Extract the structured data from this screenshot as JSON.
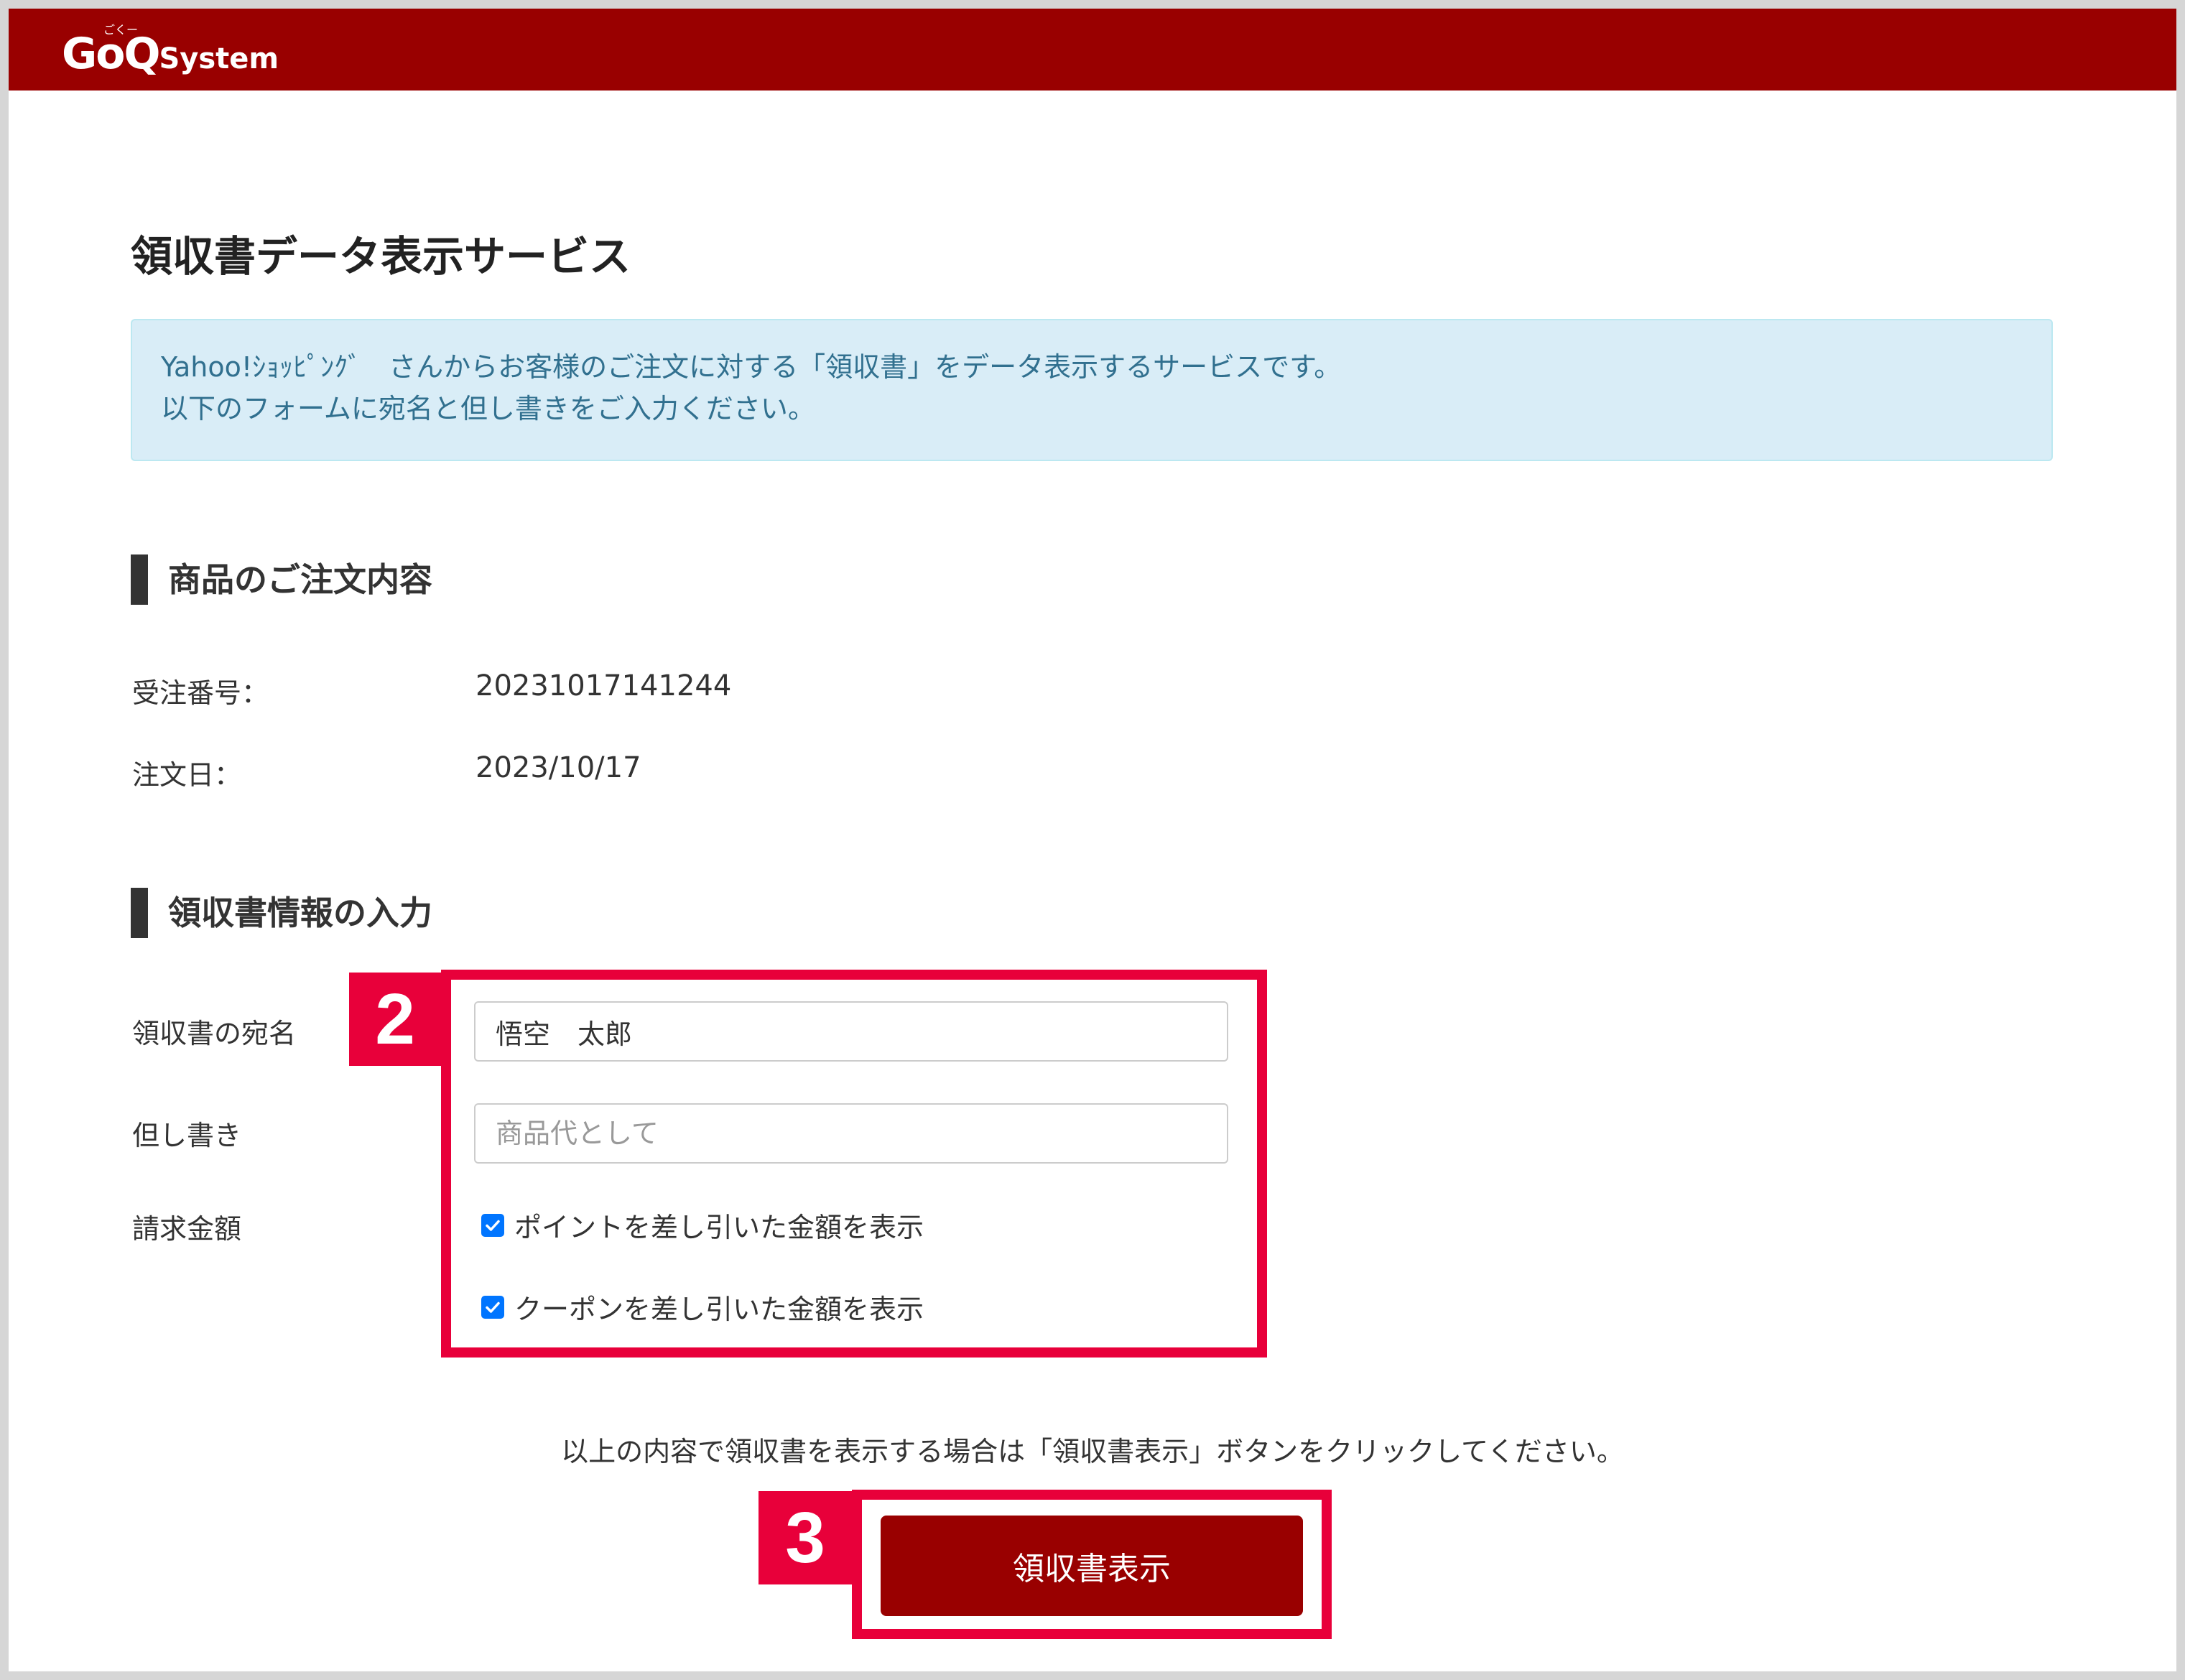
{
  "header": {
    "logo_text": "GoQ",
    "logo_sub": "System",
    "logo_ruby": "ごくー",
    "color": "#990000"
  },
  "page": {
    "title": "領収書データ表示サービス"
  },
  "info": {
    "line1": "Yahoo!ｼｮｯﾋﾟﾝｸﾞ　さんからお客様のご注文に対する「領収書」をデータ表示するサービスです。",
    "line2": "以下のフォームに宛名と但し書きをご入力ください。"
  },
  "order_section": {
    "title": "商品のご注文内容",
    "order_number_label": "受注番号：",
    "order_number": "20231017141244",
    "order_date_label": "注文日：",
    "order_date": "2023/10/17"
  },
  "receipt_section": {
    "title": "領収書情報の入力",
    "addressee_label": "領収書の宛名",
    "addressee_value": "悟空　太郎",
    "memo_label": "但し書き",
    "memo_placeholder": "商品代として",
    "amount_label": "請求金額",
    "checkbox_points": "ポイントを差し引いた金額を表示",
    "checkbox_coupons": "クーポンを差し引いた金額を表示"
  },
  "annotations": {
    "step2": "2",
    "step3": "3",
    "highlight_color": "#e8003a"
  },
  "footer": {
    "instruction": "以上の内容で領収書を表示する場合は「領収書表示」ボタンをクリックしてください。",
    "submit_label": "領収書表示"
  }
}
